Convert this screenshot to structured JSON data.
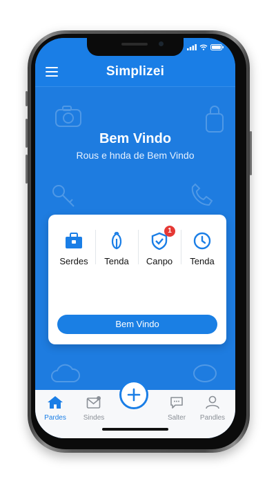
{
  "header": {
    "title": "Simplizei"
  },
  "welcome": {
    "title": "Bem Vindo",
    "subtitle": "Rous e hnda de Bem Vindo"
  },
  "card": {
    "items": [
      {
        "label": "Serdes",
        "icon": "briefcase-icon"
      },
      {
        "label": "Tenda",
        "icon": "tent-icon"
      },
      {
        "label": "Canpo",
        "icon": "shield-check-icon",
        "badge": "1"
      },
      {
        "label": "Tenda",
        "icon": "clock-icon"
      }
    ],
    "button_label": "Bem Vindo"
  },
  "tabbar": {
    "items": [
      {
        "label": "Pardes",
        "icon": "home-icon",
        "active": true
      },
      {
        "label": "Sindes",
        "icon": "mail-icon",
        "active": false
      },
      {
        "label": "Salter",
        "icon": "chat-icon",
        "active": false
      },
      {
        "label": "Pandles",
        "icon": "user-icon",
        "active": false
      }
    ],
    "fab_icon": "plus-icon"
  },
  "colors": {
    "primary": "#1a7ee6",
    "badge": "#e53935",
    "tab_inactive": "#8a8f96"
  }
}
